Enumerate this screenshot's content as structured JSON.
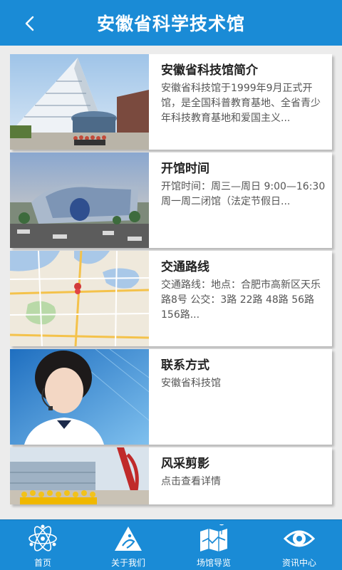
{
  "header": {
    "title": "安徽省科学技术馆",
    "back_icon": "chevron-left-icon"
  },
  "cards": [
    {
      "title": "安徽省科技馆简介",
      "desc": "安徽省科技馆于1999年9月正式开馆，是全国科普教育基地、全省青少年科技教育基地和爱国主义..."
    },
    {
      "title": "开馆时间",
      "desc": "开馆时间：周三—周日 9:00—16:30 周一周二闭馆（法定节假日..."
    },
    {
      "title": "交通路线",
      "desc": "交通路线：地点：合肥市高新区天乐路8号 公交：3路 22路 48路 56路 156路..."
    },
    {
      "title": "联系方式",
      "desc": "安徽省科技馆"
    },
    {
      "title": "风采剪影",
      "desc": "点击查看详情"
    }
  ],
  "tabs": [
    {
      "label": "首页",
      "icon": "atom-icon"
    },
    {
      "label": "关于我们",
      "icon": "triangle-logo-icon"
    },
    {
      "label": "场馆导览",
      "icon": "map-icon"
    },
    {
      "label": "资讯中心",
      "icon": "eye-icon"
    }
  ],
  "colors": {
    "primary": "#1a8bd6",
    "background": "#ececec",
    "card": "#ffffff"
  }
}
